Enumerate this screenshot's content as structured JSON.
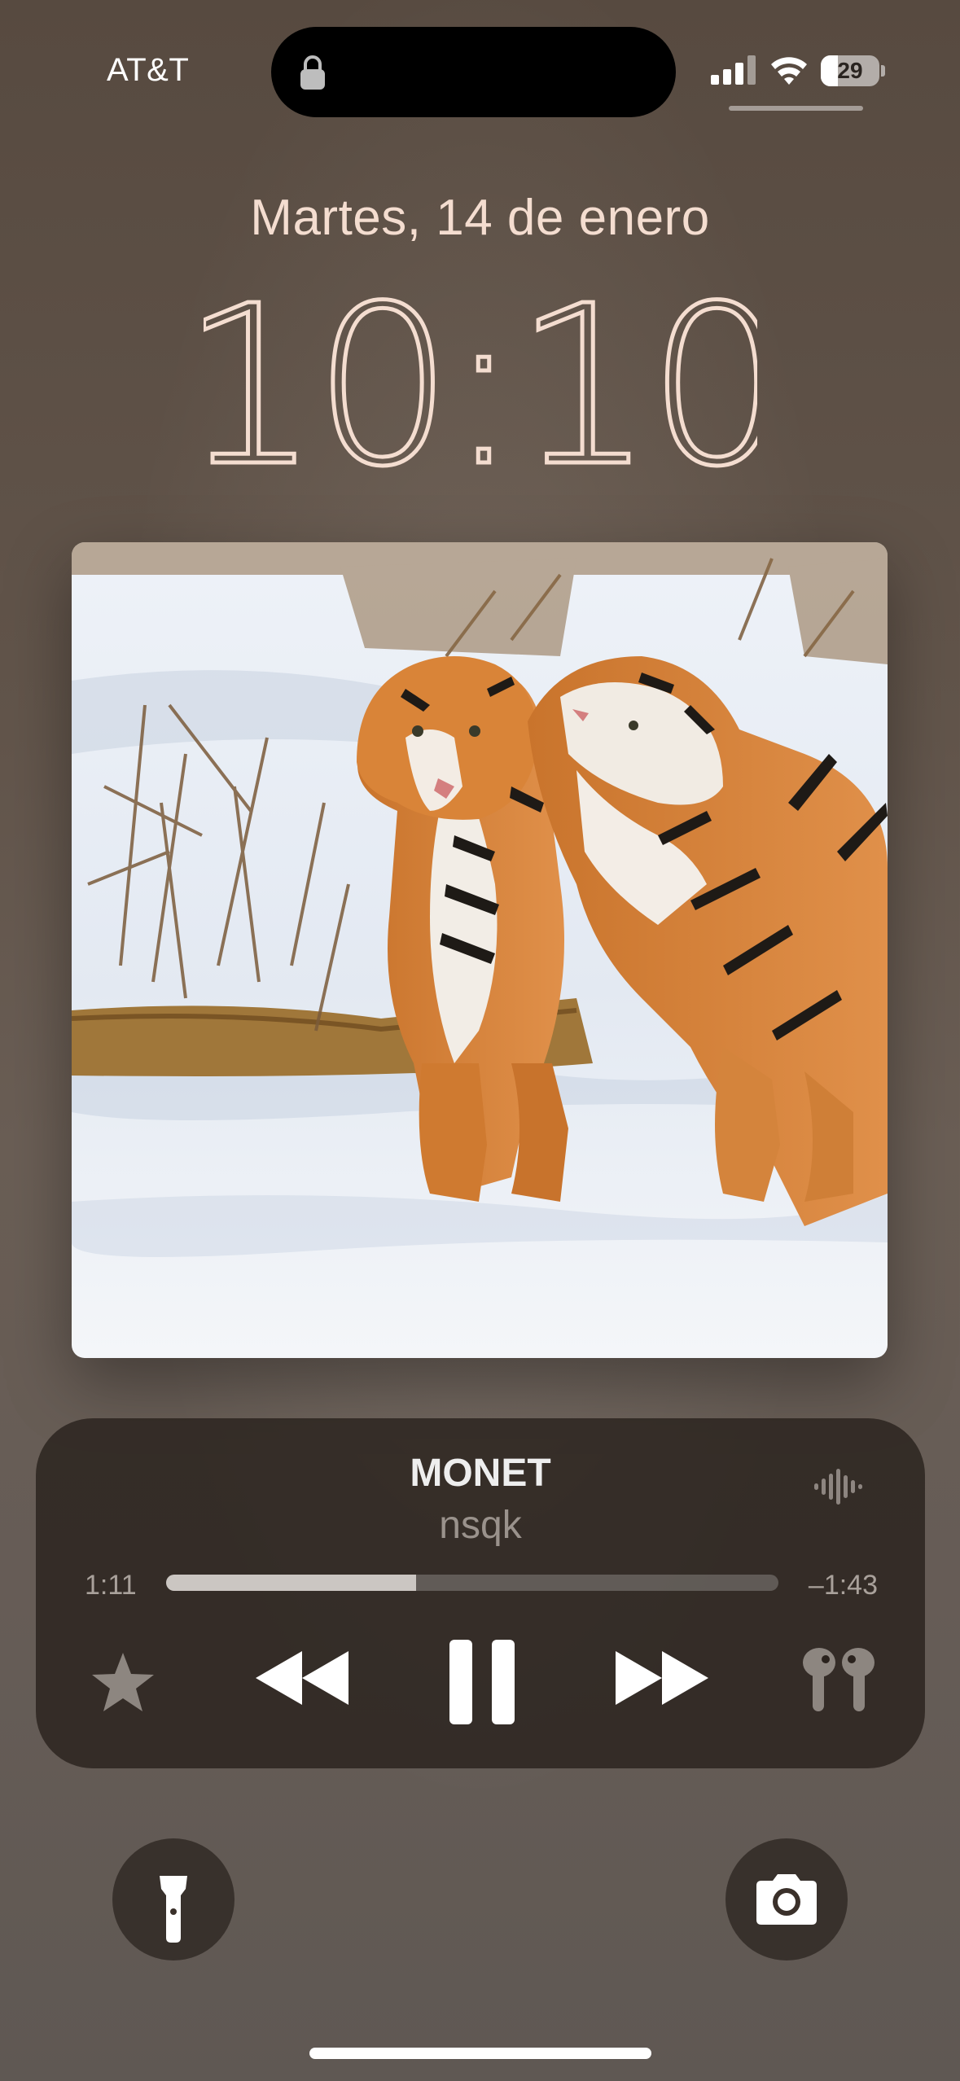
{
  "status_bar": {
    "carrier": "AT&T",
    "battery_level": "29",
    "icons": [
      "lock-icon",
      "signal-icon",
      "wifi-icon",
      "battery-icon"
    ]
  },
  "lockscreen": {
    "date": "Martes, 14 de enero",
    "time": "10:10"
  },
  "now_playing": {
    "artwork": "two-tigers-in-snow",
    "title": "MONET",
    "artist": "nsqk",
    "elapsed": "1:11",
    "remaining": "–1:43",
    "progress_fraction": 0.408,
    "controls": [
      "star-icon",
      "rewind-icon",
      "pause-icon",
      "fast-forward-icon",
      "airpods-icon"
    ]
  },
  "quick_actions": {
    "left": "flashlight-icon",
    "right": "camera-icon"
  },
  "colors": {
    "clock_text": "#f4ddd0",
    "player_background": "#2a221d"
  }
}
